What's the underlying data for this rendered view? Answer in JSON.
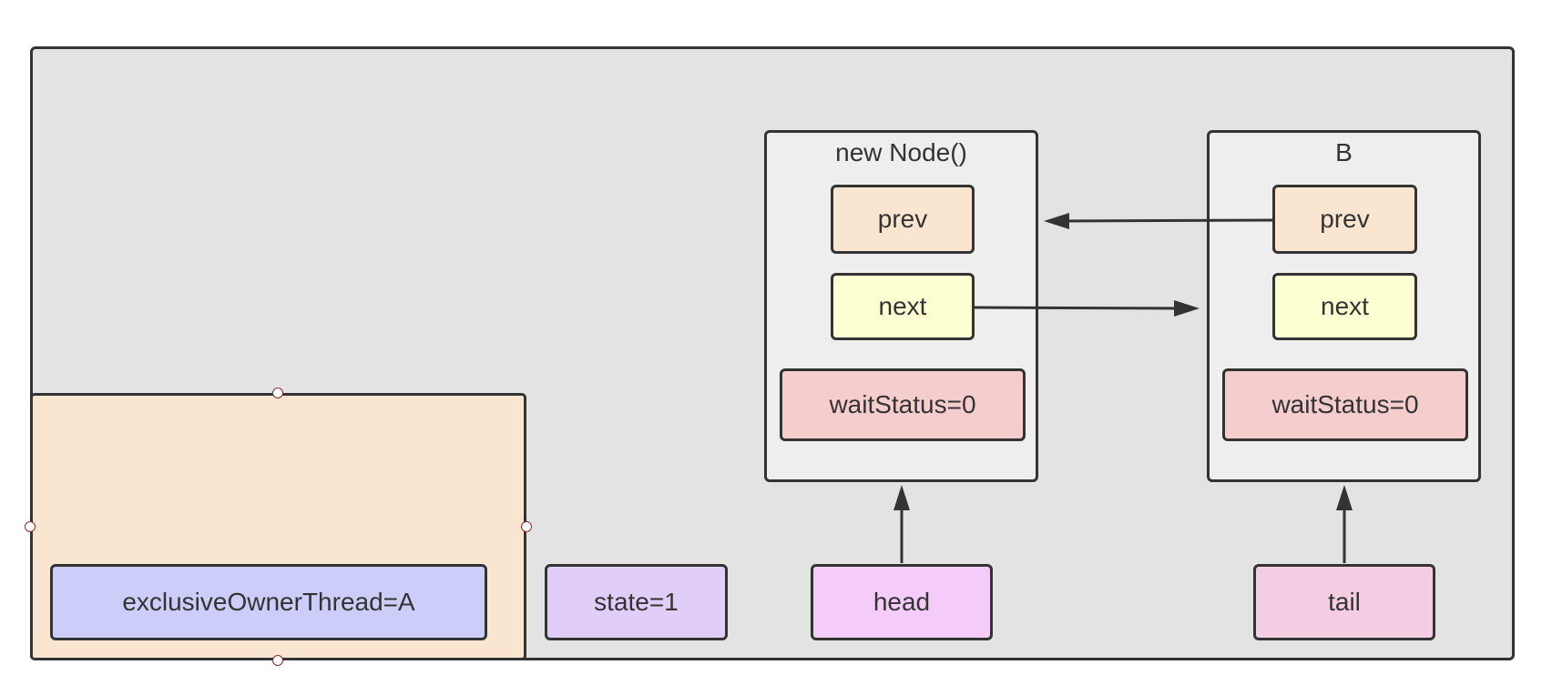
{
  "colors": {
    "outer": "#e3e3e3",
    "node": "#eeeeee",
    "prev": "#fae6d0",
    "next": "#fefed3",
    "wait": "#f6cdcd",
    "owner": "#cccdf8",
    "state": "#e1cef8",
    "head": "#f5ccf9",
    "tail": "#f5cde2",
    "container": "#fae6d0",
    "stroke": "#333333"
  },
  "owner_label": "exclusiveOwnerThread=A",
  "state_label": "state=1",
  "head_label": "head",
  "tail_label": "tail",
  "nodes": [
    {
      "title": "new Node()",
      "prev": "prev",
      "next": "next",
      "wait": "waitStatus=0"
    },
    {
      "title": "B",
      "prev": "prev",
      "next": "next",
      "wait": "waitStatus=0"
    }
  ]
}
